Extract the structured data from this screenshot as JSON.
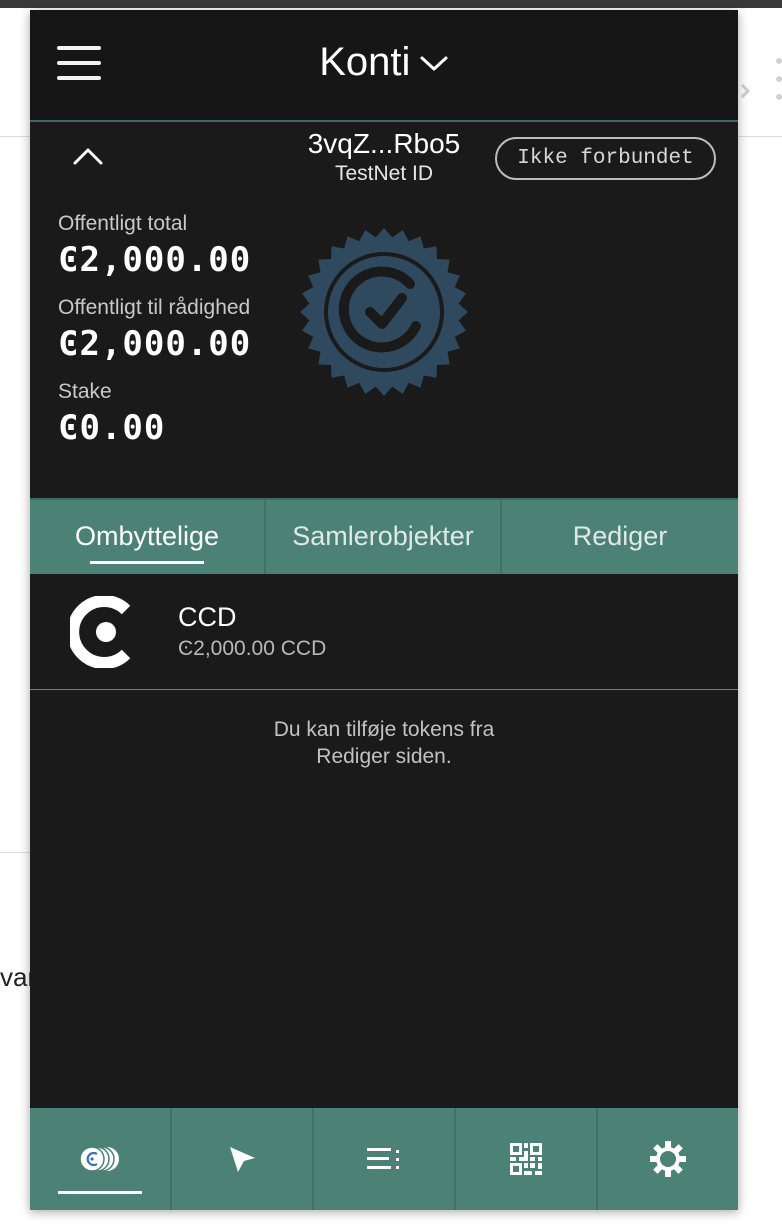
{
  "header": {
    "title": "Konti"
  },
  "account": {
    "address": "3vqZ...Rbo5",
    "network_label": "TestNet ID",
    "connection_status": "Ikke forbundet",
    "balances": [
      {
        "label": "Offentligt total",
        "value": "Ͼ2,000.00"
      },
      {
        "label": "Offentligt til rådighed",
        "value": "Ͼ2,000.00"
      },
      {
        "label": "Stake",
        "value": "Ͼ0.00"
      }
    ]
  },
  "tabs": [
    {
      "label": "Ombyttelige",
      "active": true
    },
    {
      "label": "Samlerobjekter",
      "active": false
    },
    {
      "label": "Rediger",
      "active": false
    }
  ],
  "tokens": [
    {
      "name": "CCD",
      "amount": "Ͼ2,000.00 CCD",
      "icon": "ccd-logo-icon"
    }
  ],
  "info_message": {
    "line1": "Du kan tilføje tokens fra",
    "line2": "Rediger siden."
  },
  "bottom_nav": [
    {
      "icon": "accounts-icon",
      "active": true
    },
    {
      "icon": "send-icon",
      "active": false
    },
    {
      "icon": "transaction-list-icon",
      "active": false
    },
    {
      "icon": "qr-code-icon",
      "active": false
    },
    {
      "icon": "settings-gear-icon",
      "active": false
    }
  ],
  "background": {
    "partial_text": "var"
  },
  "colors": {
    "accent": "#4b8275",
    "popup_bg": "#1a1a1a",
    "seal": "#2f4a5e"
  }
}
